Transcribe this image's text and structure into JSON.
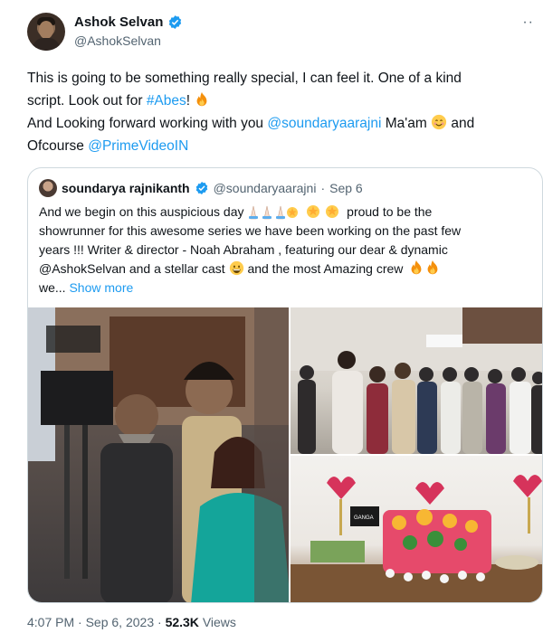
{
  "author": {
    "display_name": "Ashok Selvan",
    "handle": "@AshokSelvan",
    "more_icon": "more-horizontal-icon"
  },
  "tweet": {
    "line1": "This is going to be something really special, I can feel it. One of a kind",
    "line2_pre": "script. Look out for ",
    "hashtag": "#Abes",
    "line2_post": "!",
    "line3_pre": "And Looking forward working with you ",
    "mention1": "@soundaryaarajni",
    "line3_post": " Ma'am",
    "line3_end": " and",
    "line4_pre": "Ofcourse ",
    "mention2": "@PrimeVideoIN"
  },
  "quote": {
    "display_name": "soundarya rajnikanth",
    "handle": "@soundaryaarajni",
    "dot": "·",
    "date": "Sep 6",
    "line1_pre": "And we begin on this auspicious day ",
    "line1_post": " proud to be the",
    "line2": "showrunner for this awesome series we have been working on the past few",
    "line3": "years !!! Writer & director - Noah Abraham , featuring our dear & dynamic",
    "line4_pre": "@AshokSelvan and a stellar cast ",
    "line4_post": " and the most Amazing crew ",
    "line5_pre": "we... ",
    "show_more": "Show more",
    "photo_text": "GANGA"
  },
  "footer": {
    "time": "4:07 PM",
    "sep": "·",
    "date": "Sep 6, 2023",
    "views_count": "52.3K",
    "views_label": "Views"
  },
  "colors": {
    "link": "#1d9bf0",
    "muted": "#536471",
    "verified": "#1d9bf0",
    "border": "#cfd9de"
  }
}
